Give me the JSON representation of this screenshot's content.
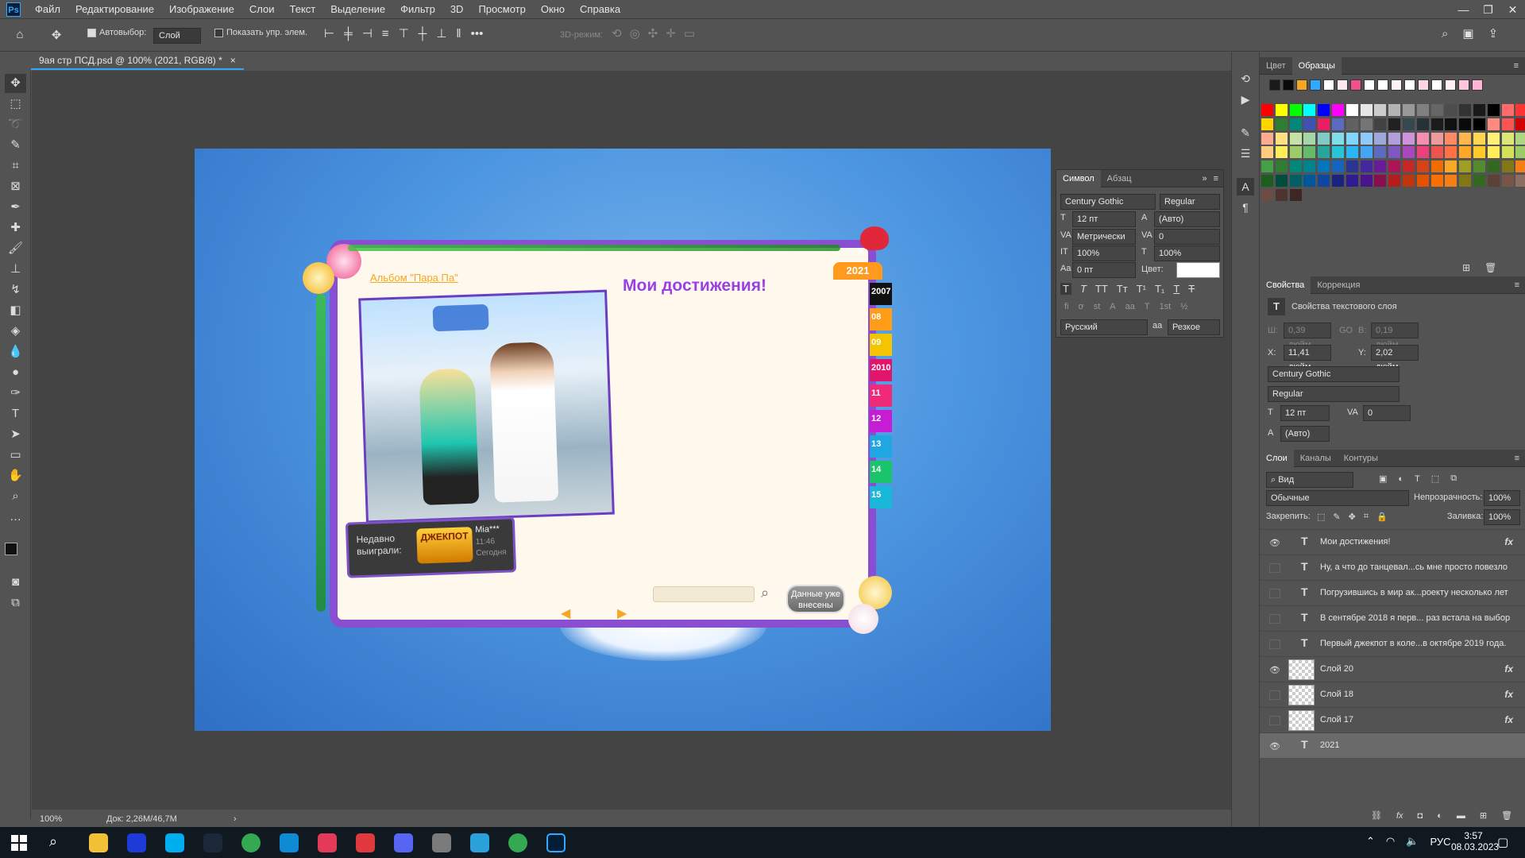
{
  "menu": {
    "logo": "Ps",
    "items": [
      "Файл",
      "Редактирование",
      "Изображение",
      "Слои",
      "Текст",
      "Выделение",
      "Фильтр",
      "3D",
      "Просмотр",
      "Окно",
      "Справка"
    ]
  },
  "window_controls": {
    "minimize": "—",
    "restore": "❐",
    "close": "✕"
  },
  "options": {
    "autoselect_label": "Автовыбор:",
    "autoselect_value": "Слой",
    "show_controls_label": "Показать упр. элем.",
    "mode_3d_label": "3D-режим:"
  },
  "document_tab": {
    "title": "9ая стр ПСД.psd @ 100% (2021, RGB/8) *",
    "close": "×"
  },
  "status": {
    "zoom": "100%",
    "doc": "Док: 2,26M/46,7M",
    "arrow": "›"
  },
  "color_panel": {
    "tabs": [
      "Цвет",
      "Образцы"
    ],
    "active": "Образцы"
  },
  "properties_panel": {
    "tabs": [
      "Свойства",
      "Коррекция"
    ],
    "title": "Свойства текстового слоя",
    "w_label": "Ш:",
    "w_value": "0,39 дюйм",
    "go_label": "GO",
    "h_label": "В:",
    "h_value": "0,19 дюйм",
    "x_label": "X:",
    "x_value": "11,41 дюйм",
    "y_label": "Y:",
    "y_value": "2,02 дюйм",
    "font": "Century Gothic",
    "style": "Regular",
    "size": "12 пт",
    "tracking": "0",
    "leading": "(Авто)"
  },
  "character_panel": {
    "tabs": [
      "Символ",
      "Абзац"
    ],
    "font": "Century Gothic",
    "style": "Regular",
    "size": "12 пт",
    "leading": "(Авто)",
    "kerning": "Метрически",
    "tracking": "0",
    "vscale": "100%",
    "hscale": "100%",
    "baseline": "0 пт",
    "color_label": "Цвет:",
    "language": "Русский",
    "aa_label": "aa",
    "antialias": "Резкое"
  },
  "layers_panel": {
    "tabs": [
      "Слои",
      "Каналы",
      "Контуры"
    ],
    "filter": "Вид",
    "blend": "Обычные",
    "opacity_label": "Непрозрачность:",
    "opacity": "100%",
    "lock_label": "Закрепить:",
    "fill_label": "Заливка:",
    "fill": "100%",
    "layers": [
      {
        "name": "Мои достижения!",
        "type": "text",
        "visible": true,
        "fx": true
      },
      {
        "name": "Ну, а что до танцевал...сь мне просто повезло",
        "type": "text",
        "visible": false,
        "fx": false
      },
      {
        "name": "Погрузившись в мир ак...роекту несколько лет",
        "type": "text",
        "visible": false,
        "fx": false
      },
      {
        "name": "В сентябре 2018 я перв... раз встала на  выбор",
        "type": "text",
        "visible": false,
        "fx": false
      },
      {
        "name": "Первый джекпот в коле...в октябре 2019 года.",
        "type": "text",
        "visible": false,
        "fx": false
      },
      {
        "name": "Слой 20",
        "type": "pixel",
        "visible": true,
        "fx": true
      },
      {
        "name": "Слой 18",
        "type": "pixel",
        "visible": false,
        "fx": true
      },
      {
        "name": "Слой 17",
        "type": "pixel",
        "visible": false,
        "fx": true
      },
      {
        "name": "2021",
        "type": "text",
        "visible": true,
        "fx": false,
        "selected": true
      }
    ]
  },
  "artwork": {
    "album_link": "Альбом \"Пара Па\"",
    "heading": "Мои достижения!",
    "year_badge": "2021",
    "close_x": "✕",
    "years": [
      "2007",
      "08",
      "09",
      "2010",
      "11",
      "12",
      "13",
      "14",
      "15"
    ],
    "recent_label": "Недавно выиграли:",
    "jackpot": "ДЖЕКПОТ",
    "winner_name": "Mia***",
    "winner_time": "11:46",
    "winner_day": "Сегодня",
    "data_button": "Данные уже внесены"
  },
  "taskbar": {
    "lang": "РУС",
    "time": "3:57",
    "date": "08.03.2023",
    "apps": [
      "file-explorer",
      "xbox",
      "skype",
      "steam",
      "chrome",
      "edge",
      "camera",
      "game",
      "discord",
      "creative-cloud",
      "telegram",
      "chrome",
      "photoshop"
    ]
  },
  "colors": {
    "ui_bg": "#535353",
    "accent": "#31a8ff",
    "frame_purple": "#8a4fd1",
    "canvas_blue": "#4c95e0"
  }
}
